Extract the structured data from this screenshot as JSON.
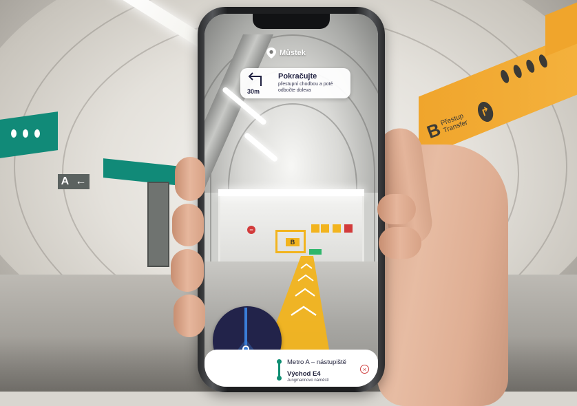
{
  "location": {
    "name": "Můstek"
  },
  "instruction": {
    "distance": "30m",
    "title": "Pokračujte",
    "subtitle": "přestupní chodbou a poté odbočte doleva"
  },
  "destination": {
    "line1": "Metro A – nástupiště",
    "line2": "Východ E4",
    "line3": "Jungmannovo náměstí"
  },
  "signs": {
    "left_station_sign": "A",
    "right_station_letter": "B",
    "right_station_words": "Přestup Transfer",
    "ar_sign_letter": "B"
  },
  "colors": {
    "brand_green": "#0f8e73",
    "compass_bg": "#22234a",
    "path_yellow": "#f2b41e",
    "orange_band": "#f0a52c",
    "close_red": "#d04040"
  },
  "icons": {
    "location": "map-pin-icon",
    "turn": "turn-left-arrow-icon",
    "close": "close-icon",
    "compass": "compass-arrow-icon"
  }
}
